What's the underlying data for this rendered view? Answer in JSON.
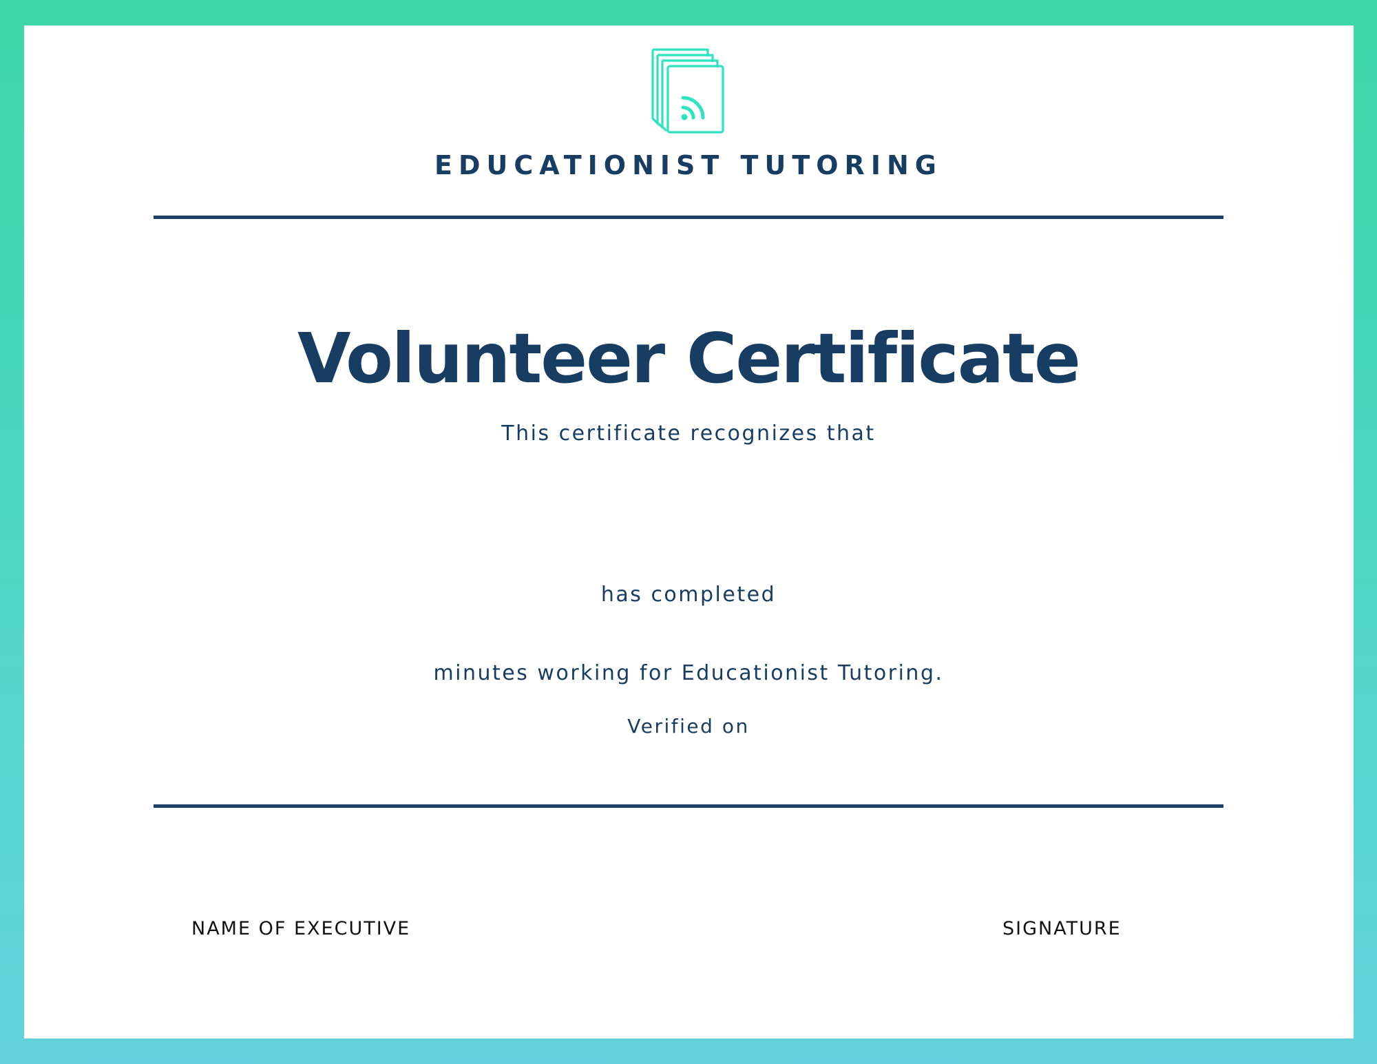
{
  "certificate": {
    "organization": "EDUCATIONIST TUTORING",
    "title": "Volunteer Certificate",
    "recognizes_text": "This certificate recognizes that",
    "completed_text": "has completed",
    "minutes_text": "minutes working for Educationist Tutoring.",
    "verified_text": "Verified on"
  },
  "footer": {
    "executive_label": "NAME OF EXECUTIVE",
    "signature_label": "SIGNATURE"
  },
  "icons": {
    "logo": "stacked-documents-rss-icon"
  },
  "colors": {
    "border_top": "#3cd7a6",
    "border_bottom": "#62d1dd",
    "text_navy": "#173d63",
    "logo_accent": "#2de3c0"
  }
}
